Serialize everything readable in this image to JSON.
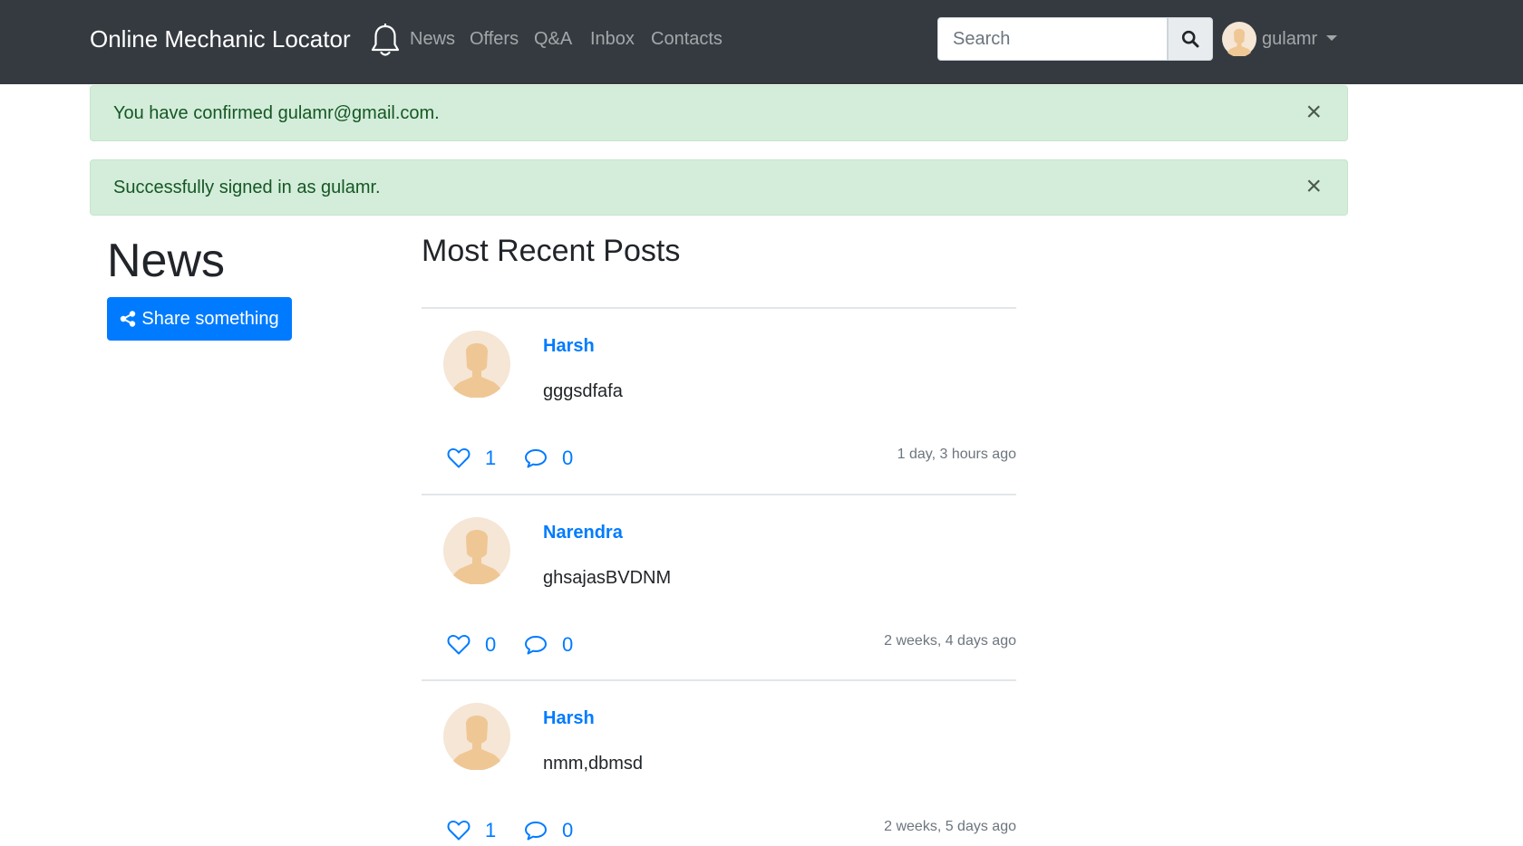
{
  "navbar": {
    "brand": "Online Mechanic Locator",
    "links": [
      "News",
      "Offers",
      "Q&A",
      "Inbox",
      "Contacts"
    ],
    "search_placeholder": "Search",
    "user": "gulamr"
  },
  "alerts": [
    {
      "text": "You have confirmed gulamr@gmail.com.",
      "close": "×"
    },
    {
      "text": "Successfully signed in as gulamr.",
      "close": "×"
    }
  ],
  "sidebar": {
    "heading": "News",
    "share_label": "Share something"
  },
  "main": {
    "heading": "Most Recent Posts",
    "posts": [
      {
        "author": "Harsh",
        "body": "gggsdfafa",
        "likes": "1",
        "comments": "0",
        "time": "1 day, 3 hours ago"
      },
      {
        "author": "Narendra",
        "body": "ghsajasBVDNM",
        "likes": "0",
        "comments": "0",
        "time": "2 weeks, 4 days ago"
      },
      {
        "author": "Harsh",
        "body": "nmm,dbmsd",
        "likes": "1",
        "comments": "0",
        "time": "2 weeks, 5 days ago"
      }
    ]
  },
  "colors": {
    "navbar_bg": "#343a40",
    "accent": "#007bff",
    "alert_success_bg": "#d4edda",
    "alert_success_text": "#155724"
  },
  "icons": {
    "notifications": "bell-icon",
    "search": "search-icon",
    "share": "share-icon",
    "like": "heart-icon",
    "comment": "comment-icon"
  }
}
